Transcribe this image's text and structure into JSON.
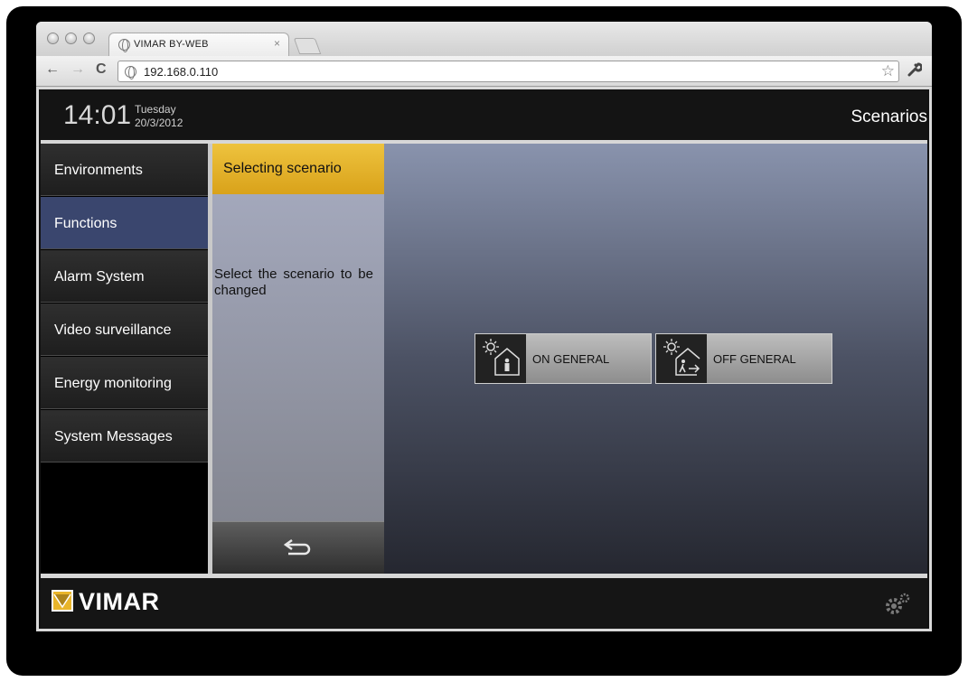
{
  "browser": {
    "tab_title": "VIMAR BY-WEB",
    "tab_close": "×",
    "url": "192.168.0.110",
    "back": "←",
    "forward": "→",
    "reload": "C",
    "star": "☆",
    "wrench": "🔧"
  },
  "header": {
    "time": "14:01",
    "day": "Tuesday",
    "date": "20/3/2012",
    "section": "Scenarios"
  },
  "sidebar": {
    "items": [
      {
        "label": "Environments"
      },
      {
        "label": "Functions",
        "active": true
      },
      {
        "label": "Alarm System"
      },
      {
        "label": "Video surveillance"
      },
      {
        "label": "Energy monitoring"
      },
      {
        "label": "System Messages"
      }
    ]
  },
  "panel": {
    "header": "Selecting scenario",
    "instruction": "Select the scenario to be changed"
  },
  "scenarios": [
    {
      "label": "ON GENERAL",
      "icon": "house-person-sun-icon"
    },
    {
      "label": "OFF GENERAL",
      "icon": "house-exit-sun-icon"
    }
  ],
  "footer": {
    "brand": "VIMAR"
  },
  "colors": {
    "active_nav": "#3a466e",
    "panel_header": "#e3b02b"
  }
}
